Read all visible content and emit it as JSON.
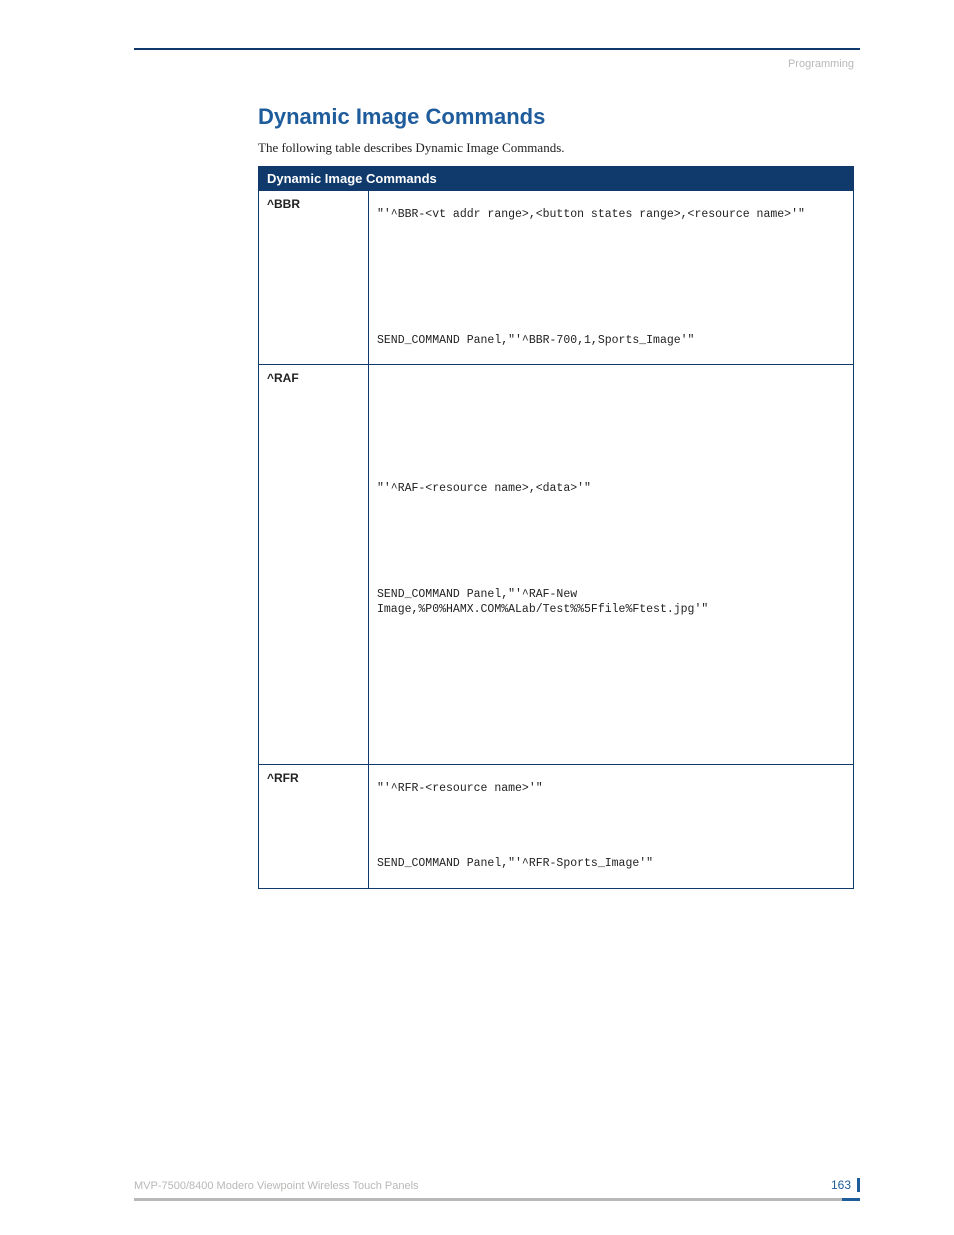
{
  "header": {
    "section": "Programming"
  },
  "title": "Dynamic Image Commands",
  "intro": "The following table describes  Dynamic Image Commands.",
  "table": {
    "caption": "Dynamic Image Commands",
    "rows": {
      "bbr": {
        "name": "^BBR",
        "syntax": "\"'^BBR-<vt addr range>,<button states range>,<resource name>'\"",
        "example": "SEND_COMMAND Panel,\"'^BBR-700,1,Sports_Image'\""
      },
      "raf": {
        "name": "^RAF",
        "syntax": "\"'^RAF-<resource name>,<data>'\"",
        "example": "SEND_COMMAND Panel,\"'^RAF-New Image,%P0%HAMX.COM%ALab/Test%%5Ffile%Ftest.jpg'\""
      },
      "rfr": {
        "name": "^RFR",
        "syntax": "\"'^RFR-<resource name>'\"",
        "example": "SEND_COMMAND Panel,\"'^RFR-Sports_Image'\""
      }
    }
  },
  "footer": {
    "doc": "MVP-7500/8400 Modero Viewpoint Wireless Touch Panels",
    "page": "163"
  }
}
